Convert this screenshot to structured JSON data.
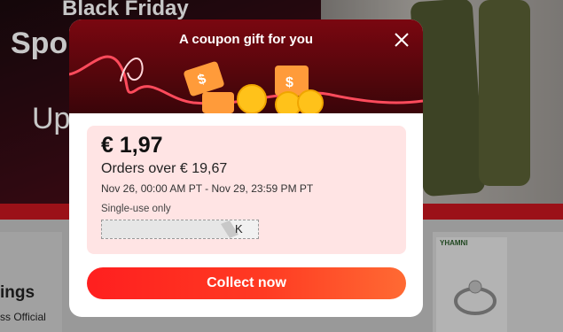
{
  "background": {
    "banner_heading": "Black Friday",
    "banner_line_1": "Spo",
    "banner_line_2": "Up",
    "section_title": "ings",
    "section_subtitle": "ss Official",
    "product_brand": "YHAMNI"
  },
  "modal": {
    "title": "A coupon gift for you",
    "close_icon": "close-icon",
    "coupon": {
      "amount": "€ 1,97",
      "min_order": "Orders over € 19,67",
      "validity": "Nov 26, 00:00 AM PT - Nov 29, 23:59 PM PT",
      "usage": "Single-use only",
      "code_suffix": "K"
    },
    "collect_label": "Collect now"
  },
  "colors": {
    "header_dark_red": "#3a0509",
    "coupon_bg": "#ffe4e4",
    "button_start": "#ff1f1f",
    "button_end": "#ff6a33"
  }
}
